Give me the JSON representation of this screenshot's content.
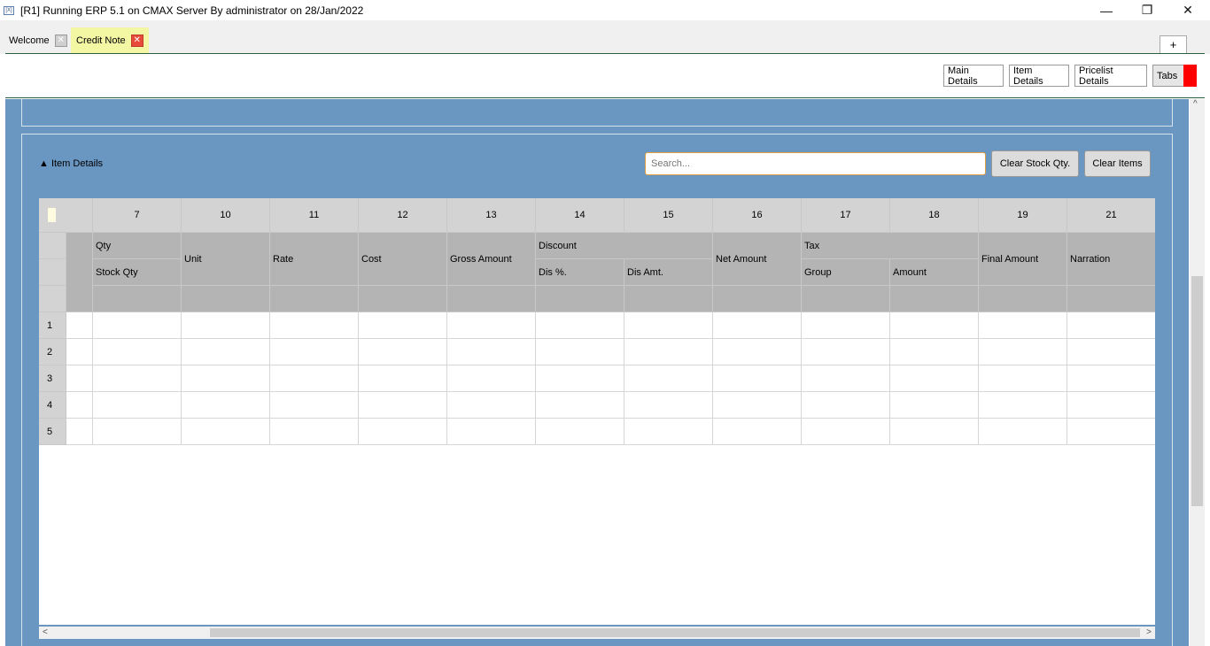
{
  "window": {
    "icon_text": "[X]",
    "title": "[R1] Running ERP 5.1 on CMAX Server By administrator on 28/Jan/2022",
    "minimize": "—",
    "maximize": "❐",
    "close": "✕"
  },
  "tabs": [
    {
      "label": "Welcome",
      "close": "✕"
    },
    {
      "label": "Credit Note",
      "close": "✕"
    }
  ],
  "new_tab_label": "+",
  "toolbar": {
    "main_details": "Main Details",
    "item_details": "Item Details",
    "pricelist_details": "Pricelist Details",
    "tabs": "Tabs"
  },
  "item_section": {
    "title": "▲ Item Details",
    "search_placeholder": "Search...",
    "clear_stock_qty": "Clear Stock Qty.",
    "clear_items": "Clear Items"
  },
  "grid": {
    "column_numbers": [
      "7",
      "10",
      "11",
      "12",
      "13",
      "14",
      "15",
      "16",
      "17",
      "18",
      "19",
      "21"
    ],
    "headers": {
      "qty": "Qty",
      "stock_qty": "Stock Qty",
      "unit": "Unit",
      "rate": "Rate",
      "cost": "Cost",
      "gross_amount": "Gross Amount",
      "discount": "Discount",
      "dis_pct": "Dis %.",
      "dis_amt": "Dis Amt.",
      "net_amount": "Net Amount",
      "tax": "Tax",
      "group": "Group",
      "amount": "Amount",
      "final_amount": "Final Amount",
      "narration": "Narration"
    },
    "row_numbers": [
      "1",
      "2",
      "3",
      "4",
      "5"
    ]
  },
  "scroll": {
    "left": "<",
    "right": ">",
    "up": "^"
  }
}
